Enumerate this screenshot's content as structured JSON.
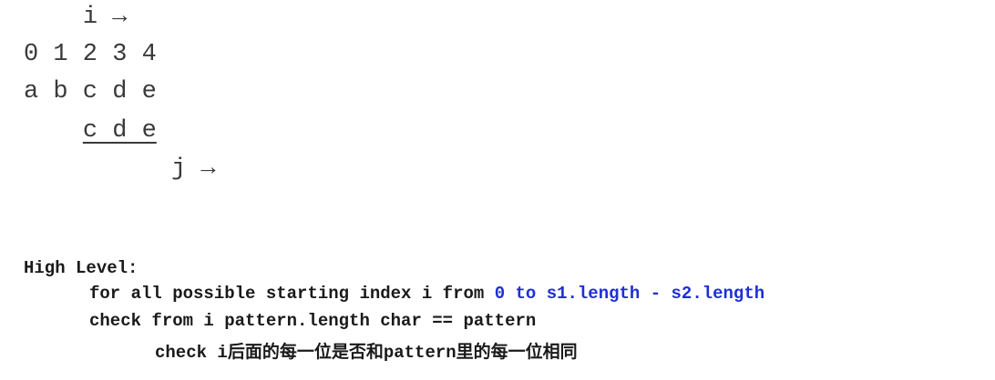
{
  "diagram": {
    "pointer_i": "i →",
    "indices": "0 1 2 3 4",
    "text_chars": "a b c d e",
    "pattern_chars": "c d e",
    "pointer_j": "j →"
  },
  "notes": {
    "title": "High Level:",
    "line1_prefix": "for all possible starting index i from ",
    "line1_range": "0 to s1.length - s2.length",
    "line2": "check from i pattern.length char == pattern",
    "line3_prefix": "check i",
    "line3_cjk_1": "后面的每一位是否和",
    "line3_mid": "pattern",
    "line3_cjk_2": "里的每一位相同"
  },
  "colors": {
    "diagram_text": "#3a3a3a",
    "code_text": "#1a1a1a",
    "range_highlight": "#1f2fd4"
  }
}
